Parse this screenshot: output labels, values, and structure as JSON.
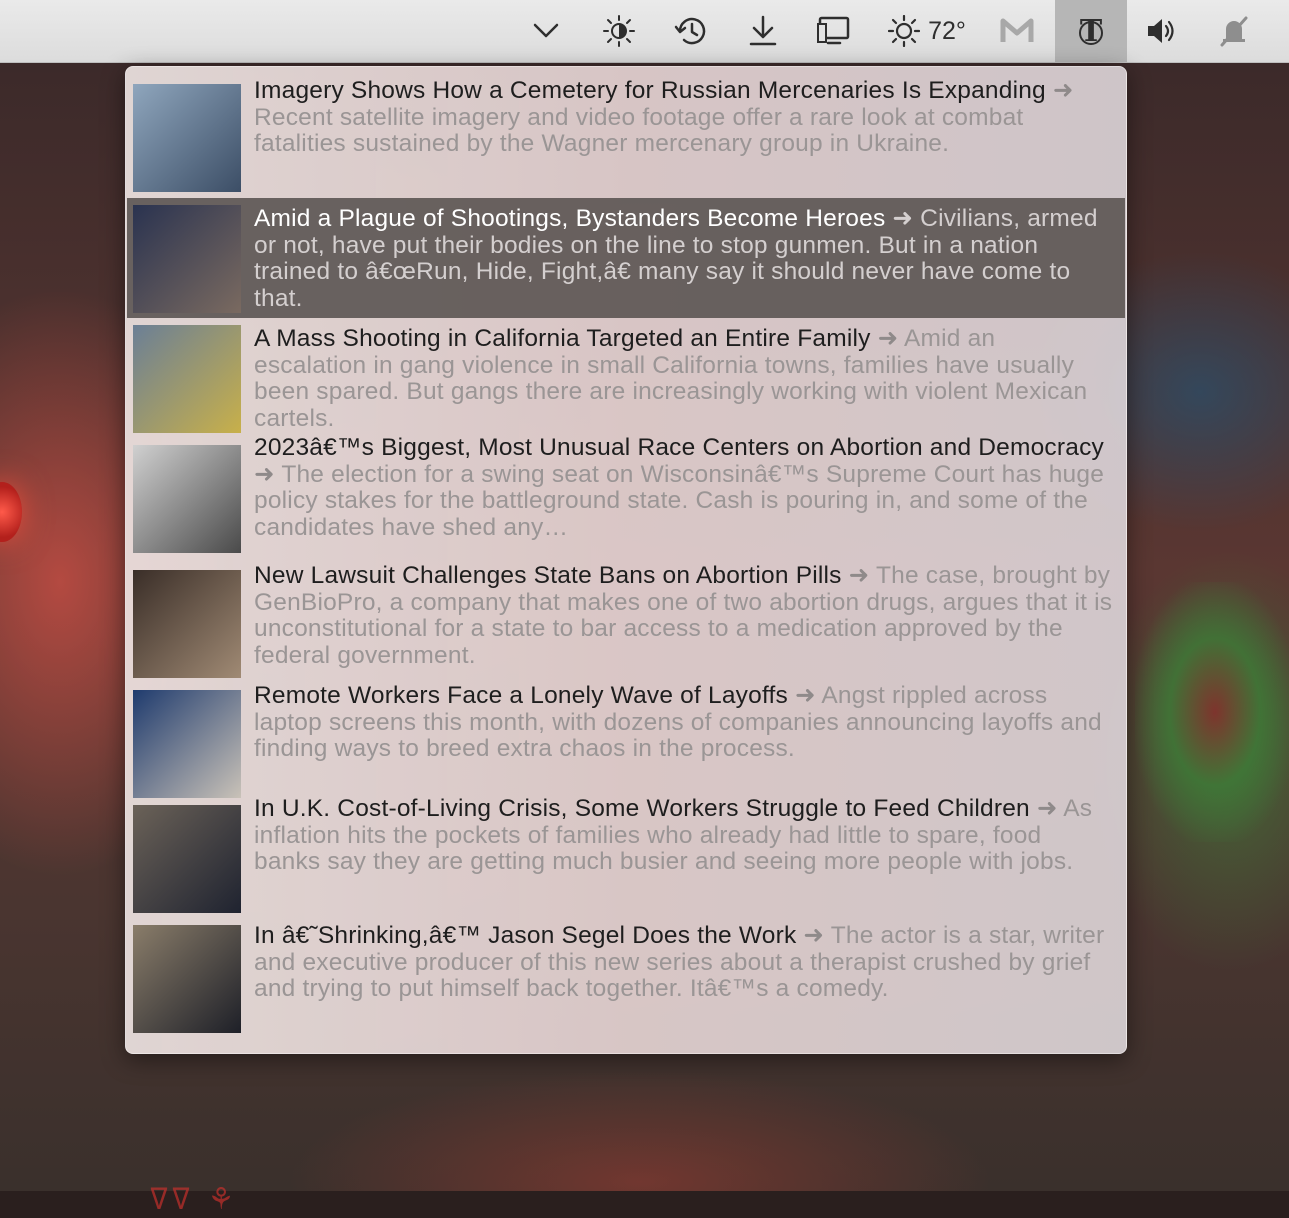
{
  "menubar": {
    "items": [
      {
        "name": "chevron-down-icon"
      },
      {
        "name": "brightness-icon"
      },
      {
        "name": "history-icon"
      },
      {
        "name": "download-icon"
      },
      {
        "name": "display-icon"
      },
      {
        "name": "weather-sun-icon",
        "text": "72°"
      },
      {
        "name": "gmail-icon"
      },
      {
        "name": "nyt-icon",
        "active": true
      },
      {
        "name": "volume-icon"
      },
      {
        "name": "notifications-muted-icon"
      }
    ]
  },
  "news": {
    "items": [
      {
        "title": "Imagery Shows How a Cemetery for Russian Mercenaries Is Expanding",
        "arrow": "➜",
        "summary": "Recent satellite imagery and video footage offer a rare look at combat fatalities sustained by the Wagner mercenary group in Ukraine.",
        "thumb_colors": [
          "#8fa6bd",
          "#3c4e66"
        ]
      },
      {
        "title": "Amid a Plague of Shootings, Bystanders Become Heroes",
        "arrow": "➜",
        "summary": "Civilians, armed or not, have put their bodies on the line to stop gunmen. But in a nation trained to â€œRun, Hide, Fight,â€ many say it should never have come to that.",
        "selected": true,
        "thumb_colors": [
          "#2a3350",
          "#7a6a60"
        ]
      },
      {
        "title": "A Mass Shooting in California Targeted an Entire Family",
        "arrow": "➜",
        "summary": "Amid an escalation in gang violence in small California towns, families have usually been spared. But gangs there are increasingly working with violent Mexican cartels.",
        "thumb_colors": [
          "#6b7f96",
          "#c8b04a"
        ]
      },
      {
        "title": "2023â€™s Biggest, Most Unusual Race Centers on Abortion and Democracy",
        "arrow": "➜",
        "summary": "The election for a swing seat on Wisconsinâ€™s Supreme Court has huge policy stakes for the battleground state. Cash is pouring in, and some of the candidates have shed any…",
        "thumb_colors": [
          "#d0d0d0",
          "#4a4a4a"
        ]
      },
      {
        "title": "New Lawsuit Challenges State Bans on Abortion Pills",
        "arrow": "➜",
        "summary": "The case, brought by GenBioPro, a company that makes one of two abortion drugs, argues that it is unconstitutional for a state to bar access to a medication approved by the federal government.",
        "thumb_colors": [
          "#3a2e28",
          "#a08a74"
        ]
      },
      {
        "title": "Remote Workers Face a Lonely Wave of Layoffs",
        "arrow": "➜",
        "summary": "Angst rippled across laptop screens this month, with dozens of companies announcing layoffs and finding ways to breed extra chaos in the process.",
        "thumb_colors": [
          "#1f3b6e",
          "#c9c2b8"
        ]
      },
      {
        "title": "In U.K. Cost-of-Living Crisis, Some Workers Struggle to Feed Children",
        "arrow": "➜",
        "summary": "As inflation hits the pockets of families who already had little to spare, food banks say they are getting much busier and seeing more people with jobs.",
        "thumb_colors": [
          "#6b6258",
          "#1f2330"
        ]
      },
      {
        "title": "In â€˜Shrinking,â€™ Jason Segel Does the Work",
        "arrow": "➜",
        "summary": "The actor is a star, writer and executive producer of this new series about a therapist crushed by grief and trying to put himself back together. Itâ€™s a comedy.",
        "thumb_colors": [
          "#8a7d6a",
          "#1e2028"
        ]
      }
    ]
  }
}
